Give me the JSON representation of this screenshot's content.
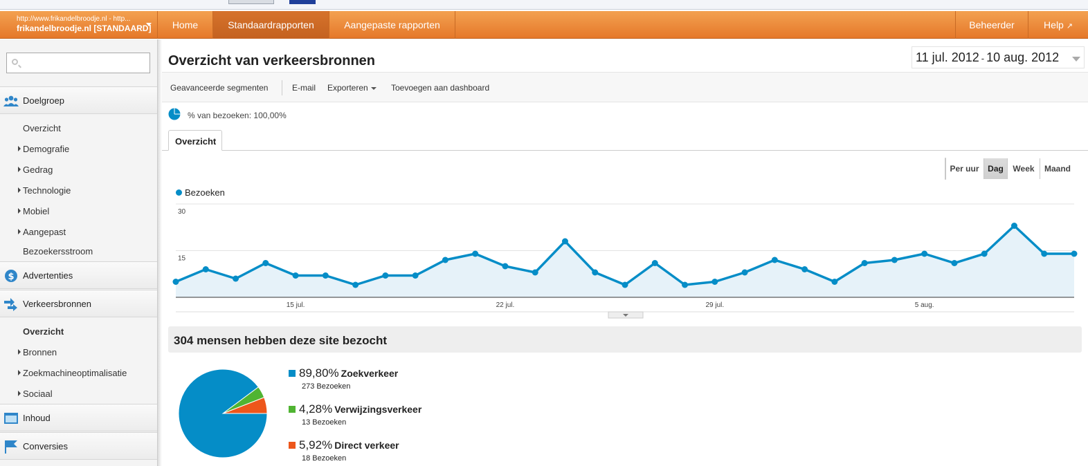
{
  "colors": {
    "brand_orange": "#e97f2f",
    "series_blue": "#058dc7",
    "green": "#50b432",
    "red": "#ed561b"
  },
  "header": {
    "profile_url": "http://www.frikandelbroodje.nl - http...",
    "profile_name": "frikandelbroodje.nl [STANDAARD]",
    "tabs": [
      {
        "label": "Home"
      },
      {
        "label": "Standaardrapporten",
        "active": true
      },
      {
        "label": "Aangepaste rapporten"
      }
    ],
    "admin_label": "Beheerder",
    "help_label": "Help",
    "help_icon": "external-link-icon"
  },
  "sidebar": {
    "search_placeholder": "",
    "sections": [
      {
        "label": "Doelgroep",
        "icon": "people-icon"
      },
      {
        "label": "Advertenties",
        "icon": "dollar-icon"
      },
      {
        "label": "Verkeersbronnen",
        "icon": "arrows-icon"
      },
      {
        "label": "Inhoud",
        "icon": "window-icon"
      },
      {
        "label": "Conversies",
        "icon": "flag-icon"
      }
    ],
    "doelgroep_items": [
      "Overzicht",
      "Demografie",
      "Gedrag",
      "Technologie",
      "Mobiel",
      "Aangepast",
      "Bezoekersstroom"
    ],
    "verkeersbronnen_items": [
      "Overzicht",
      "Bronnen",
      "Zoekmachineoptimalisatie",
      "Sociaal"
    ]
  },
  "main": {
    "title": "Overzicht van verkeersbronnen",
    "date_start": "11 jul. 2012",
    "date_sep": "-",
    "date_end": "10 aug. 2012",
    "toolbar": {
      "segments": "Geavanceerde segmenten",
      "email": "E-mail",
      "export": "Exporteren",
      "dashboard": "Toevoegen aan dashboard"
    },
    "segment_label": "% van bezoeken: 100,00%",
    "tab_label": "Overzicht",
    "granularity": [
      "Per uur",
      "Dag",
      "Week",
      "Maand"
    ],
    "granularity_active": "Dag",
    "summary": "304 mensen hebben deze site bezocht",
    "breakdown": [
      {
        "pct": "89,80%",
        "name": "Zoekverkeer",
        "count": "273 Bezoeken",
        "color": "#058dc7"
      },
      {
        "pct": "4,28%",
        "name": "Verwijzingsverkeer",
        "count": "13 Bezoeken",
        "color": "#50b432"
      },
      {
        "pct": "5,92%",
        "name": "Direct verkeer",
        "count": "18 Bezoeken",
        "color": "#ed561b"
      }
    ]
  },
  "chart_data": {
    "type": "area",
    "series": [
      {
        "name": "Bezoeken",
        "values": [
          5,
          9,
          6,
          11,
          7,
          7,
          4,
          7,
          7,
          12,
          14,
          10,
          8,
          18,
          8,
          4,
          11,
          4,
          5,
          8,
          12,
          9,
          5,
          11,
          12,
          14,
          11,
          14,
          23,
          14,
          14
        ]
      }
    ],
    "x": [
      "11 jul.",
      "12 jul.",
      "13 jul.",
      "14 jul.",
      "15 jul.",
      "16 jul.",
      "17 jul.",
      "18 jul.",
      "19 jul.",
      "20 jul.",
      "21 jul.",
      "22 jul.",
      "23 jul.",
      "24 jul.",
      "25 jul.",
      "26 jul.",
      "27 jul.",
      "28 jul.",
      "29 jul.",
      "30 jul.",
      "31 jul.",
      "1 aug.",
      "2 aug.",
      "3 aug.",
      "4 aug.",
      "5 aug.",
      "6 aug.",
      "7 aug.",
      "8 aug.",
      "9 aug.",
      "10 aug."
    ],
    "x_ticks": [
      "15 jul.",
      "22 jul.",
      "29 jul.",
      "5 aug."
    ],
    "y_ticks": [
      "30",
      "15"
    ],
    "ylim": [
      0,
      30
    ],
    "legend": "top-left",
    "grid": true
  }
}
